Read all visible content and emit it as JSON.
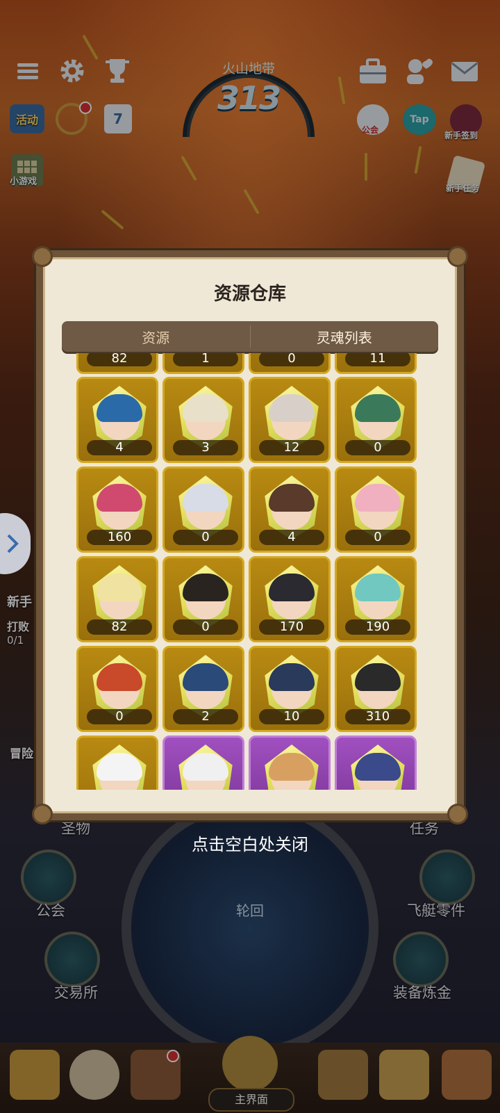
{
  "hud": {
    "zone_name": "火山地带",
    "zone_level": "313",
    "left_labels": [
      "活动",
      "小游戏"
    ],
    "right_labels": [
      "公会",
      "Tap",
      "新手签到",
      "新手任务"
    ]
  },
  "side": {
    "newbie": "新手",
    "defeat": "打败",
    "progress": "0/1",
    "adventure": "冒险"
  },
  "background_menu": {
    "relic": "圣物",
    "task": "任务",
    "guild": "公会",
    "airship_parts": "飞艇零件",
    "exchange": "交易所",
    "equip_alchemy": "装备炼金",
    "reincarnate": "轮回",
    "close_hint": "点击空白处关闭",
    "main_screen": "主界面"
  },
  "modal": {
    "title": "资源仓库",
    "tabs": [
      {
        "label": "资源",
        "active": false
      },
      {
        "label": "灵魂列表",
        "active": true
      }
    ]
  },
  "souls": {
    "partial_top_row": [
      "82",
      "1",
      "0",
      "11"
    ],
    "rows": [
      [
        {
          "count": "4",
          "hair": "#2a6aa8"
        },
        {
          "count": "3",
          "hair": "#e8e0c8"
        },
        {
          "count": "12",
          "hair": "#d8d0c8"
        },
        {
          "count": "0",
          "hair": "#3a7a5a"
        }
      ],
      [
        {
          "count": "160",
          "hair": "#d04a70"
        },
        {
          "count": "0",
          "hair": "#d8dce6"
        },
        {
          "count": "4",
          "hair": "#5a3a2a"
        },
        {
          "count": "0",
          "hair": "#f0b0c0"
        }
      ],
      [
        {
          "count": "82",
          "hair": "#f0e2a0"
        },
        {
          "count": "0",
          "hair": "#2a2420"
        },
        {
          "count": "170",
          "hair": "#2a2a30"
        },
        {
          "count": "190",
          "hair": "#70c8c0"
        }
      ],
      [
        {
          "count": "0",
          "hair": "#c84a2a"
        },
        {
          "count": "2",
          "hair": "#2a4a7a"
        },
        {
          "count": "10",
          "hair": "#2a3a5a"
        },
        {
          "count": "310",
          "hair": "#2a2a2a"
        }
      ]
    ],
    "partial_bottom_row": [
      {
        "hair": "#f4f4f4",
        "rarity": "gold"
      },
      {
        "hair": "#f0f0f0",
        "rarity": "purple"
      },
      {
        "hair": "#d8a060",
        "rarity": "purple"
      },
      {
        "hair": "#3a4a8a",
        "rarity": "purple"
      }
    ]
  },
  "colors": {
    "gold_frame": "#d4a820",
    "purple_frame": "#c080d8",
    "modal_bg": "#efe8d6",
    "tab_bar": "#6e5a45"
  },
  "icons": {
    "menu": "hamburger-icon",
    "settings": "gear-icon",
    "trophy": "trophy-icon",
    "toolbox": "toolbox-icon",
    "friends": "friends-icon",
    "mail": "mail-icon"
  }
}
